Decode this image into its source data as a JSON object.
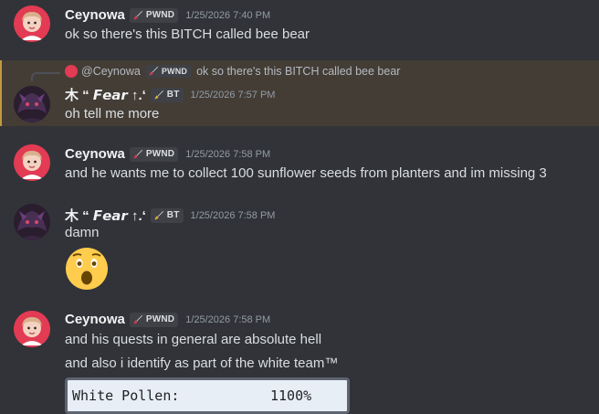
{
  "messages": [
    {
      "username": "Ceynowa",
      "tag": "PWND",
      "timestamp": "1/25/2026 7:40 PM",
      "lines": [
        "ok so there's this BITCH called bee bear"
      ]
    },
    {
      "reply": {
        "mention": "@Ceynowa",
        "tag": "PWND",
        "text": "ok so there's this BITCH called bee bear"
      },
      "username": "木 “ 𝙁𝙚𝙖𝙧 ↑.‘",
      "tag": "BT",
      "timestamp": "1/25/2026 7:57 PM",
      "lines": [
        "oh tell me more"
      ]
    },
    {
      "username": "Ceynowa",
      "tag": "PWND",
      "timestamp": "1/25/2026 7:58 PM",
      "lines": [
        "and he wants me to collect 100 sunflower seeds from planters and im missing 3"
      ]
    },
    {
      "username": "木 “ 𝙁𝙚𝙖𝙧 ↑.‘",
      "tag": "BT",
      "timestamp": "1/25/2026 7:58 PM",
      "lines": [
        "damn"
      ],
      "emoji": "astonished-face-emoji"
    },
    {
      "username": "Ceynowa",
      "tag": "PWND",
      "timestamp": "1/25/2026 7:58 PM",
      "lines": [
        "and his quests in general are absolute hell",
        "and also i identify as part of the white team™"
      ],
      "embed": {
        "label": "White Pollen:",
        "value": "1100%"
      }
    }
  ],
  "colors": {
    "background": "#313338",
    "reply_highlight": "#433d36",
    "reply_accent": "#c29a3b",
    "username": "#f2f3f5",
    "timestamp": "#949ba4"
  },
  "icons": {
    "tag_icon": "sword-icon",
    "reply_connector": "reply-spine-icon"
  }
}
